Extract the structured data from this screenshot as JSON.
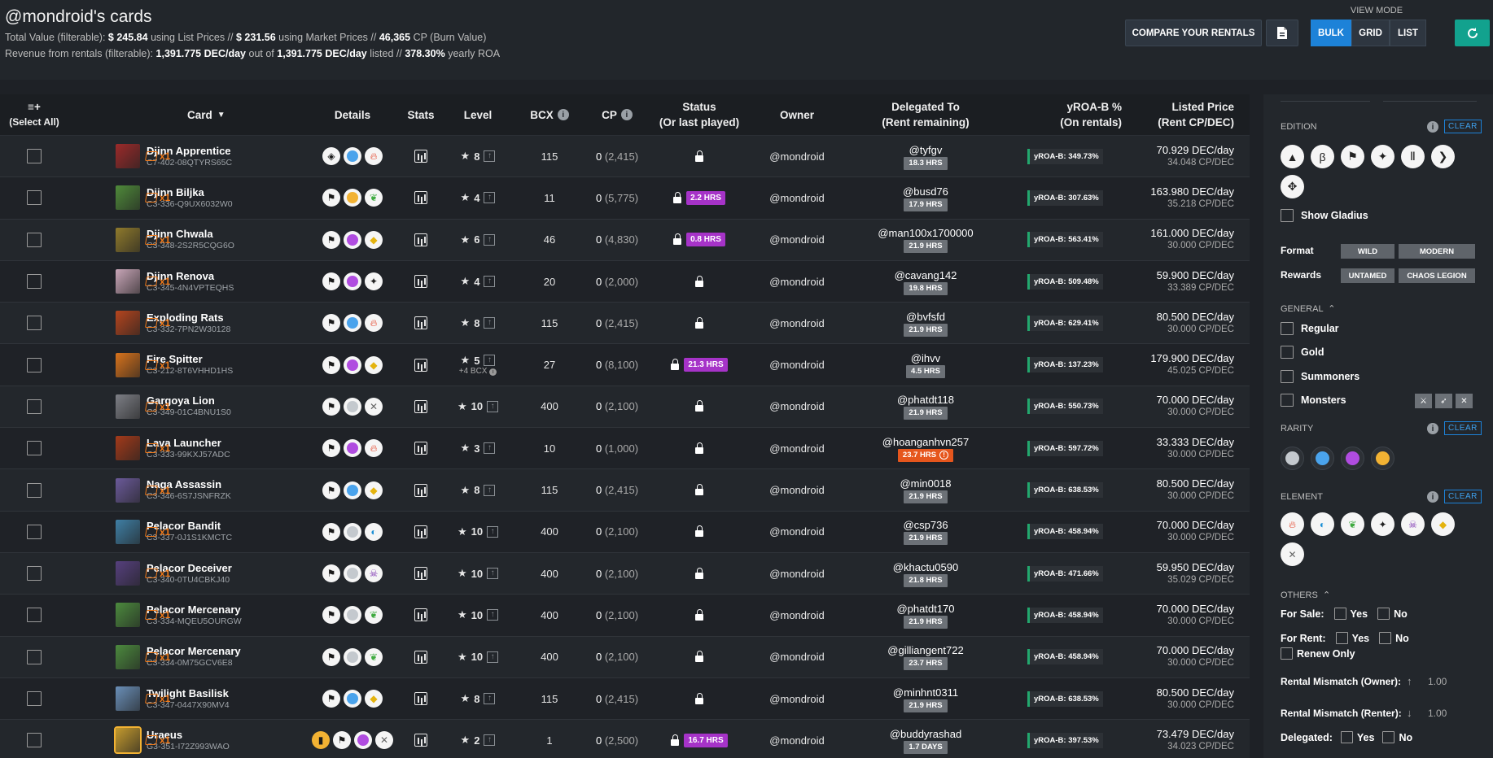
{
  "header": {
    "title": "@mondroid's cards",
    "line1": {
      "label1": "Total Value (filterable):",
      "value1": "$ 245.84",
      "text1": "using List Prices //",
      "value2": "$ 231.56",
      "text2": "using Market Prices //",
      "value3": "46,365",
      "text3": "CP (Burn Value)"
    },
    "line2": {
      "label1": "Revenue from rentals (filterable):",
      "value1": "1,391.775 DEC/day",
      "text1": "out of",
      "value2": "1,391.775 DEC/day",
      "text2": "listed //",
      "value3": "378.30%",
      "text3": "yearly ROA"
    },
    "compare_button": "COMPARE YOUR RENTALS",
    "view_mode_label": "VIEW MODE",
    "view_modes": [
      "BULK",
      "GRID",
      "LIST"
    ],
    "active_view": "BULK"
  },
  "columns": {
    "select_icon": "≡+",
    "select_all": "(Select All)",
    "card": "Card",
    "details": "Details",
    "stats": "Stats",
    "level": "Level",
    "bcx": "BCX",
    "cp": "CP",
    "status": "Status",
    "status_sub": "(Or last played)",
    "owner": "Owner",
    "delegated": "Delegated To",
    "delegated_sub": "(Rent remaining)",
    "yroa": "yROA-B %",
    "yroa_sub": "(On rentals)",
    "price": "Listed Price",
    "price_sub": "(Rent CP/DEC)"
  },
  "rows": [
    {
      "qty": "x1",
      "name": "Djinn Apprentice",
      "id": "C7-402-08QTYRS65C",
      "thumb": "#9c2a2a",
      "d1": "◈",
      "rarity": "#4aa3ec",
      "el": "fire",
      "level": "8",
      "lvl_extra": "",
      "bcx": "115",
      "cp": "0",
      "cp_burn": "(2,415)",
      "status": "",
      "owner": "@mondroid",
      "deleg": "@tyfgv",
      "rent": "18.3 HRS",
      "warn": false,
      "yroa": "yROA-B: 349.73%",
      "price": "70.929 DEC/day",
      "cpdec": "34.048 CP/DEC"
    },
    {
      "qty": "x1",
      "name": "Djinn Biljka",
      "id": "C3-336-Q9UX6032W0",
      "thumb": "#4f8a3a",
      "d1": "⚑",
      "rarity": "#f2b233",
      "el": "earth",
      "level": "4",
      "lvl_extra": "",
      "bcx": "11",
      "cp": "0",
      "cp_burn": "(5,775)",
      "status": "2.2 HRS",
      "owner": "@mondroid",
      "deleg": "@busd76",
      "rent": "17.9 HRS",
      "warn": false,
      "yroa": "yROA-B: 307.63%",
      "price": "163.980 DEC/day",
      "cpdec": "35.218 CP/DEC"
    },
    {
      "qty": "x1",
      "name": "Djinn Chwala",
      "id": "C3-348-2S2R5CQG6O",
      "thumb": "#8f7a2c",
      "d1": "⚑",
      "rarity": "#b04ce0",
      "el": "dragon",
      "level": "6",
      "lvl_extra": "",
      "bcx": "46",
      "cp": "0",
      "cp_burn": "(4,830)",
      "status": "0.8 HRS",
      "owner": "@mondroid",
      "deleg": "@man100x1700000",
      "rent": "21.9 HRS",
      "warn": false,
      "yroa": "yROA-B: 563.41%",
      "price": "161.000 DEC/day",
      "cpdec": "30.000 CP/DEC"
    },
    {
      "qty": "x1",
      "name": "Djinn Renova",
      "id": "C3-345-4N4VPTEQHS",
      "thumb": "#c9a6b8",
      "d1": "⚑",
      "rarity": "#b04ce0",
      "el": "life",
      "level": "4",
      "lvl_extra": "",
      "bcx": "20",
      "cp": "0",
      "cp_burn": "(2,000)",
      "status": "",
      "owner": "@mondroid",
      "deleg": "@cavang142",
      "rent": "19.8 HRS",
      "warn": false,
      "yroa": "yROA-B: 509.48%",
      "price": "59.900 DEC/day",
      "cpdec": "33.389 CP/DEC"
    },
    {
      "qty": "x1",
      "name": "Exploding Rats",
      "id": "C3-332-7PN2W30128",
      "thumb": "#b5451e",
      "d1": "⚑",
      "rarity": "#4aa3ec",
      "el": "fire",
      "level": "8",
      "lvl_extra": "",
      "bcx": "115",
      "cp": "0",
      "cp_burn": "(2,415)",
      "status": "",
      "owner": "@mondroid",
      "deleg": "@bvfsfd",
      "rent": "21.9 HRS",
      "warn": false,
      "yroa": "yROA-B: 629.41%",
      "price": "80.500 DEC/day",
      "cpdec": "30.000 CP/DEC"
    },
    {
      "qty": "x1",
      "name": "Fire Spitter",
      "id": "C3-212-8T6VHHD1HS",
      "thumb": "#d8731c",
      "d1": "⚑",
      "rarity": "#b04ce0",
      "el": "dragon",
      "level": "5",
      "lvl_extra": "+4 BCX",
      "bcx": "27",
      "cp": "0",
      "cp_burn": "(8,100)",
      "status": "21.3 HRS",
      "owner": "@mondroid",
      "deleg": "@ihvv",
      "rent": "4.5 HRS",
      "warn": false,
      "yroa": "yROA-B: 137.23%",
      "price": "179.900 DEC/day",
      "cpdec": "45.025 CP/DEC"
    },
    {
      "qty": "x1",
      "name": "Gargoya Lion",
      "id": "C3-349-01C4BNU1S0",
      "thumb": "#7d7f86",
      "d1": "⚑",
      "rarity": "#c4c9ce",
      "el": "neutral",
      "level": "10",
      "lvl_extra": "",
      "bcx": "400",
      "cp": "0",
      "cp_burn": "(2,100)",
      "status": "",
      "owner": "@mondroid",
      "deleg": "@phatdt118",
      "rent": "21.9 HRS",
      "warn": false,
      "yroa": "yROA-B: 550.73%",
      "price": "70.000 DEC/day",
      "cpdec": "30.000 CP/DEC"
    },
    {
      "qty": "x1",
      "name": "Lava Launcher",
      "id": "C3-333-99KXJ57ADC",
      "thumb": "#a33a1a",
      "d1": "⚑",
      "rarity": "#b04ce0",
      "el": "fire",
      "level": "3",
      "lvl_extra": "",
      "bcx": "10",
      "cp": "0",
      "cp_burn": "(1,000)",
      "status": "",
      "owner": "@mondroid",
      "deleg": "@hoanganhvn257",
      "rent": "23.7 HRS",
      "warn": true,
      "yroa": "yROA-B: 597.72%",
      "price": "33.333 DEC/day",
      "cpdec": "30.000 CP/DEC"
    },
    {
      "qty": "x1",
      "name": "Naga Assassin",
      "id": "C3-346-6S7JSNFRZK",
      "thumb": "#6b5a9a",
      "d1": "⚑",
      "rarity": "#4aa3ec",
      "el": "dragon",
      "level": "8",
      "lvl_extra": "",
      "bcx": "115",
      "cp": "0",
      "cp_burn": "(2,415)",
      "status": "",
      "owner": "@mondroid",
      "deleg": "@min0018",
      "rent": "21.9 HRS",
      "warn": false,
      "yroa": "yROA-B: 638.53%",
      "price": "80.500 DEC/day",
      "cpdec": "30.000 CP/DEC"
    },
    {
      "qty": "x1",
      "name": "Pelacor Bandit",
      "id": "C3-337-0J1S1KMCTC",
      "thumb": "#3f7fa5",
      "d1": "⚑",
      "rarity": "#c4c9ce",
      "el": "water",
      "level": "10",
      "lvl_extra": "",
      "bcx": "400",
      "cp": "0",
      "cp_burn": "(2,100)",
      "status": "",
      "owner": "@mondroid",
      "deleg": "@csp736",
      "rent": "21.9 HRS",
      "warn": false,
      "yroa": "yROA-B: 458.94%",
      "price": "70.000 DEC/day",
      "cpdec": "30.000 CP/DEC"
    },
    {
      "qty": "x1",
      "name": "Pelacor Deceiver",
      "id": "C3-340-0TU4CBKJ40",
      "thumb": "#56407e",
      "d1": "⚑",
      "rarity": "#c4c9ce",
      "el": "death",
      "level": "10",
      "lvl_extra": "",
      "bcx": "400",
      "cp": "0",
      "cp_burn": "(2,100)",
      "status": "",
      "owner": "@mondroid",
      "deleg": "@khactu0590",
      "rent": "21.8 HRS",
      "warn": false,
      "yroa": "yROA-B: 471.66%",
      "price": "59.950 DEC/day",
      "cpdec": "35.029 CP/DEC"
    },
    {
      "qty": "x1",
      "name": "Pelacor Mercenary",
      "id": "C3-334-MQEU5OURGW",
      "thumb": "#4c8a3e",
      "d1": "⚑",
      "rarity": "#c4c9ce",
      "el": "earth",
      "level": "10",
      "lvl_extra": "",
      "bcx": "400",
      "cp": "0",
      "cp_burn": "(2,100)",
      "status": "",
      "owner": "@mondroid",
      "deleg": "@phatdt170",
      "rent": "21.9 HRS",
      "warn": false,
      "yroa": "yROA-B: 458.94%",
      "price": "70.000 DEC/day",
      "cpdec": "30.000 CP/DEC"
    },
    {
      "qty": "x1",
      "name": "Pelacor Mercenary",
      "id": "C3-334-0M75GCV6E8",
      "thumb": "#4c8a3e",
      "d1": "⚑",
      "rarity": "#c4c9ce",
      "el": "earth",
      "level": "10",
      "lvl_extra": "",
      "bcx": "400",
      "cp": "0",
      "cp_burn": "(2,100)",
      "status": "",
      "owner": "@mondroid",
      "deleg": "@gilliangent722",
      "rent": "23.7 HRS",
      "warn": false,
      "yroa": "yROA-B: 458.94%",
      "price": "70.000 DEC/day",
      "cpdec": "30.000 CP/DEC"
    },
    {
      "qty": "x1",
      "name": "Twilight Basilisk",
      "id": "C3-347-0447X90MV4",
      "thumb": "#6a8fb8",
      "d1": "⚑",
      "rarity": "#4aa3ec",
      "el": "dragon",
      "level": "8",
      "lvl_extra": "",
      "bcx": "115",
      "cp": "0",
      "cp_burn": "(2,415)",
      "status": "",
      "owner": "@mondroid",
      "deleg": "@minhnt0311",
      "rent": "21.9 HRS",
      "warn": false,
      "yroa": "yROA-B: 638.53%",
      "price": "80.500 DEC/day",
      "cpdec": "30.000 CP/DEC"
    },
    {
      "qty": "x1",
      "name": "Uraeus",
      "id": "G3-351-I72Z993WAO",
      "thumb": "#c49a2e",
      "d1": "⚑",
      "rarity": "#b04ce0",
      "el": "neutral",
      "level": "2",
      "lvl_extra": "",
      "bcx": "1",
      "cp": "0",
      "cp_burn": "(2,500)",
      "status": "16.7 HRS",
      "owner": "@mondroid",
      "deleg": "@buddyrashad",
      "rent": "1.7 DAYS",
      "warn": false,
      "yroa": "yROA-B: 397.53%",
      "price": "73.479 DEC/day",
      "cpdec": "34.023 CP/DEC"
    }
  ],
  "panel": {
    "edition_label": "EDITION",
    "clear": "CLEAR",
    "show_gladius": "Show Gladius",
    "format_label": "Format",
    "format_wild": "WILD",
    "format_modern": "MODERN",
    "rewards_label": "Rewards",
    "rewards_untamed": "UNTAMED",
    "rewards_chaos": "CHAOS LEGION",
    "general_label": "GENERAL",
    "general_items": [
      "Regular",
      "Gold",
      "Summoners",
      "Monsters"
    ],
    "rarity_label": "RARITY",
    "rarity_colors": [
      "#c4c9ce",
      "#4aa3ec",
      "#b04ce0",
      "#f2b233"
    ],
    "element_label": "ELEMENT",
    "others_label": "OTHERS",
    "for_sale": "For Sale:",
    "for_rent": "For Rent:",
    "yes": "Yes",
    "no": "No",
    "renew_only": "Renew Only",
    "mismatch_owner": "Rental Mismatch (Owner):",
    "mismatch_renter": "Rental Mismatch (Renter):",
    "mismatch_owner_val": "1.00",
    "mismatch_renter_val": "1.00",
    "delegated": "Delegated:"
  }
}
